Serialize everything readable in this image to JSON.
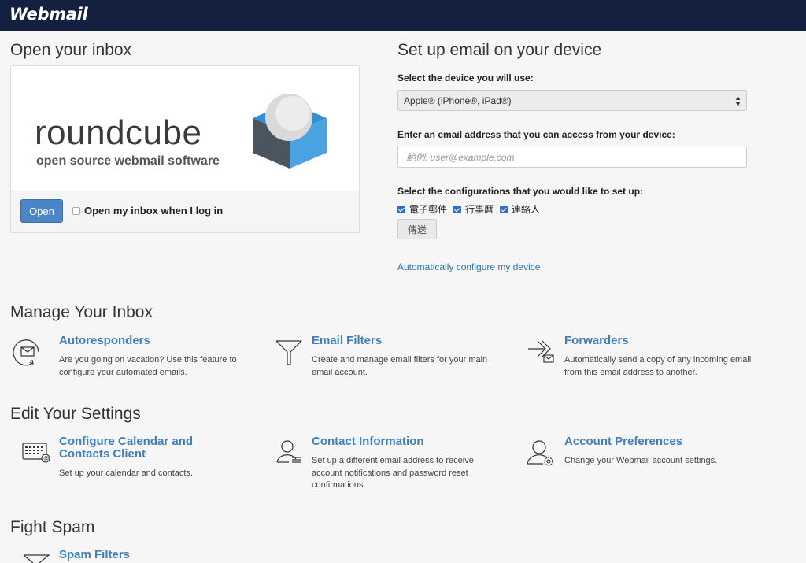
{
  "header": {
    "logo_text": "Webmail"
  },
  "open_inbox": {
    "heading": "Open your inbox",
    "roundcube_word": "roundcube",
    "roundcube_tagline": "open source webmail software",
    "open_button": "Open",
    "open_on_login_label": "Open my inbox when I log in",
    "open_on_login_checked": false
  },
  "setup": {
    "heading": "Set up email on your device",
    "device_label": "Select the device you will use:",
    "device_selected": "Apple® (iPhone®, iPad®)",
    "email_label": "Enter an email address that you can access from your device:",
    "email_placeholder": "範例: user@example.com",
    "config_label": "Select the configurations that you would like to set up:",
    "configs": [
      {
        "label": "電子郵件",
        "checked": true
      },
      {
        "label": "行事曆",
        "checked": true
      },
      {
        "label": "連絡人",
        "checked": true
      }
    ],
    "send_button": "傳送",
    "auto_config_link": "Automatically configure my device"
  },
  "manage": {
    "heading": "Manage Your Inbox",
    "items": [
      {
        "title": "Autoresponders",
        "desc": "Are you going on vacation? Use this feature to configure your automated emails.",
        "icon": "autoresponder-icon"
      },
      {
        "title": "Email Filters",
        "desc": "Create and manage email filters for your main email account.",
        "icon": "filter-icon"
      },
      {
        "title": "Forwarders",
        "desc": "Automatically send a copy of any incoming email from this email address to another.",
        "icon": "forwarder-icon"
      }
    ]
  },
  "settings": {
    "heading": "Edit Your Settings",
    "items": [
      {
        "title_line1": "Configure Calendar and",
        "title_line2": "Contacts Client",
        "desc": "Set up your calendar and contacts.",
        "icon": "calendar-icon"
      },
      {
        "title": "Contact Information",
        "desc": "Set up a different email address to receive account notifications and password reset confirmations.",
        "icon": "contact-info-icon"
      },
      {
        "title": "Account Preferences",
        "desc": "Change your Webmail account settings.",
        "icon": "account-preferences-icon"
      }
    ]
  },
  "spam": {
    "heading": "Fight Spam",
    "items": [
      {
        "title": "Spam Filters",
        "icon": "spam-filter-icon"
      }
    ]
  },
  "colors": {
    "header_bg": "#14203f",
    "link": "#3f7fbf",
    "primary_button": "#4a86c5",
    "checkbox": "#2d6fd1",
    "roundcube_blue": "#4aa3e0",
    "roundcube_dark": "#4a5560"
  }
}
